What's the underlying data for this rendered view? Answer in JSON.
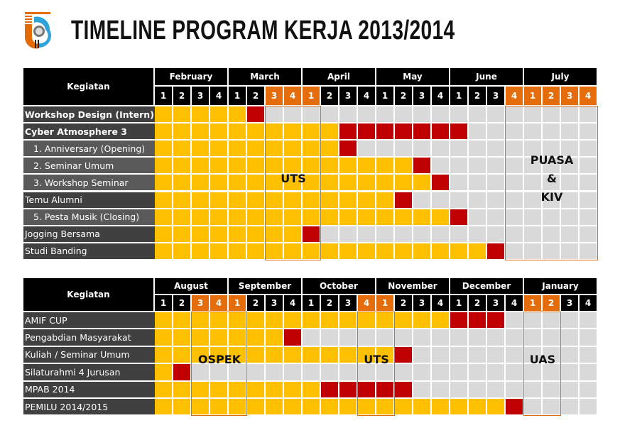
{
  "title": "TIMELINE PROGRAM KERJA 2013/2014",
  "colors": {
    "done": "#ffc000",
    "milestone": "#c00000",
    "empty": "#d9d9d9",
    "highlight": "#e46c0a",
    "header": "#000000",
    "label_dark": "#404040",
    "label_light": "#595959"
  },
  "legend_codes": {
    "Y": "done",
    "R": "milestone",
    "G": "empty"
  },
  "chart_data": [
    {
      "type": "table",
      "header_label": "Kegiatan",
      "months": [
        "February",
        "March",
        "April",
        "May",
        "June",
        "July"
      ],
      "week_labels": [
        "1",
        "2",
        "3",
        "4"
      ],
      "highlighted_weeks": [
        {
          "month": "March",
          "week": 3
        },
        {
          "month": "March",
          "week": 4
        },
        {
          "month": "April",
          "week": 1
        },
        {
          "month": "June",
          "week": 4
        },
        {
          "month": "July",
          "week": 1
        },
        {
          "month": "July",
          "week": 2
        },
        {
          "month": "July",
          "week": 3
        },
        {
          "month": "July",
          "week": 4
        }
      ],
      "rows": [
        {
          "label": "Workshop Design (Intern)",
          "style": "bold",
          "weeks": "YYYYYRGGGGGGGGGGGGGGGGGG"
        },
        {
          "label": "Cyber Atmosphere 3",
          "style": "bold",
          "weeks": "YYYYYYYYYYRRRRRRRGGGGGGG"
        },
        {
          "label": "1. Anniversary (Opening)",
          "style": "sub",
          "weeks": "YYYYYYYYYYRGGGGGGGGGGGGG"
        },
        {
          "label": "2. Seminar Umum",
          "style": "sub",
          "weeks": "YYYYYYYYYYYYYYRGGGGGGGGG"
        },
        {
          "label": "3. Workshop Seminar",
          "style": "sub",
          "weeks": "YYYYYYYYYYYYYYYRGGGGGGGG"
        },
        {
          "label": "Temu Alumni",
          "style": "normal",
          "weeks": "YYYYYYYYYYYYYRGGGGGGGGGG"
        },
        {
          "label": "5. Pesta Musik (Closing)",
          "style": "sub",
          "weeks": "YYYYYYYYYYYYYYYYRGGGGGGG"
        },
        {
          "label": "Jogging Bersama",
          "style": "normal",
          "weeks": "YYYYYYYYRGGGGGGGGGGGGGGG"
        },
        {
          "label": "Studi Banding",
          "style": "normal",
          "weeks": "YYYYYYYYYYYYYYYYYYRGGGGG"
        }
      ],
      "periods": [
        {
          "label": "UTS",
          "from": {
            "month": "March",
            "week": 3
          },
          "to": {
            "month": "April",
            "week": 1
          }
        },
        {
          "label": "PUASA\n&\nKIV",
          "from": {
            "month": "June",
            "week": 4
          },
          "to": {
            "month": "July",
            "week": 4
          }
        }
      ]
    },
    {
      "type": "table",
      "header_label": "Kegiatan",
      "months": [
        "August",
        "September",
        "October",
        "November",
        "December",
        "January"
      ],
      "week_labels": [
        "1",
        "2",
        "3",
        "4"
      ],
      "highlighted_weeks": [
        {
          "month": "August",
          "week": 3
        },
        {
          "month": "August",
          "week": 4
        },
        {
          "month": "September",
          "week": 1
        },
        {
          "month": "October",
          "week": 4
        },
        {
          "month": "November",
          "week": 1
        },
        {
          "month": "January",
          "week": 1
        },
        {
          "month": "January",
          "week": 2
        }
      ],
      "rows": [
        {
          "label": "AMIF CUP",
          "style": "normal",
          "weeks": "YYYYYYYYYYYYYYYYRRRGGGGG"
        },
        {
          "label": "Pengabdian Masyarakat",
          "style": "normal",
          "weeks": "YYYYYYYRGGGGGGGGGGGGGGGG"
        },
        {
          "label": "Kuliah / Seminar Umum",
          "style": "normal",
          "weeks": "YYYYYYYYYYYYYRGGGGGGGGGG"
        },
        {
          "label": "Silaturahmi 4 Jurusan",
          "style": "normal",
          "weeks": "YRGGGGGGGGGGGGGGGGGGGGGG"
        },
        {
          "label": "MPAB 2014",
          "style": "normal",
          "weeks": "YYYYYYYYYRRRRRGGGGGGGGGG"
        },
        {
          "label": "PEMILU 2014/2015",
          "style": "normal",
          "weeks": "YYYYYYYYYYYYYYYYYYYRGGGG"
        }
      ],
      "periods": [
        {
          "label": "OSPEK",
          "from": {
            "month": "August",
            "week": 3
          },
          "to": {
            "month": "September",
            "week": 1
          }
        },
        {
          "label": "UTS",
          "from": {
            "month": "October",
            "week": 4
          },
          "to": {
            "month": "November",
            "week": 1
          }
        },
        {
          "label": "UAS",
          "from": {
            "month": "January",
            "week": 1
          },
          "to": {
            "month": "January",
            "week": 2
          }
        }
      ]
    }
  ]
}
